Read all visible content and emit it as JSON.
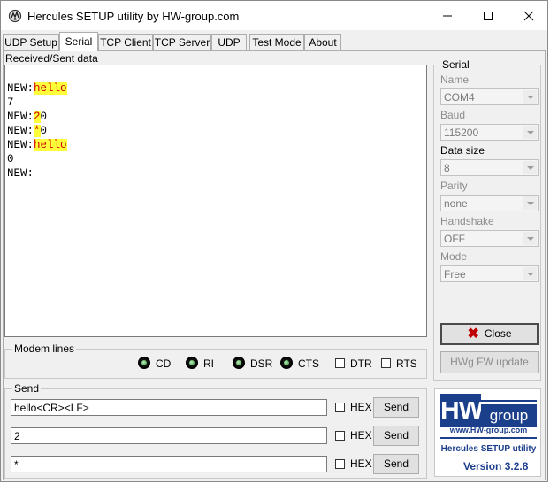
{
  "window": {
    "title": "Hercules SETUP utility by HW-group.com"
  },
  "tabs": [
    {
      "label": "UDP Setup",
      "active": false
    },
    {
      "label": "Serial",
      "active": true
    },
    {
      "label": "TCP Client",
      "active": false
    },
    {
      "label": "TCP Server",
      "active": false
    },
    {
      "label": "UDP",
      "active": false
    },
    {
      "label": "Test Mode",
      "active": false
    },
    {
      "label": "About",
      "active": false
    }
  ],
  "received": {
    "label": "Received/Sent data",
    "lines": [
      {
        "prefix": "NEW:",
        "highlight": "hello",
        "rest": ""
      },
      {
        "prefix": "7",
        "highlight": "",
        "rest": ""
      },
      {
        "prefix": "NEW:",
        "highlight": "2",
        "rest": "0"
      },
      {
        "prefix": "NEW:",
        "highlight": "*",
        "rest": "0"
      },
      {
        "prefix": "NEW:",
        "highlight": "hello",
        "rest": ""
      },
      {
        "prefix": "0",
        "highlight": "",
        "rest": ""
      },
      {
        "prefix": "NEW:",
        "highlight": "",
        "rest": ""
      }
    ]
  },
  "serial": {
    "group_label": "Serial",
    "name": {
      "label": "Name",
      "value": "COM4"
    },
    "baud": {
      "label": "Baud",
      "value": "115200"
    },
    "data_size": {
      "label": "Data size",
      "value": "8"
    },
    "parity": {
      "label": "Parity",
      "value": "none"
    },
    "handshake": {
      "label": "Handshake",
      "value": "OFF"
    },
    "mode": {
      "label": "Mode",
      "value": "Free"
    },
    "close_button": "Close",
    "fw_update_button": "HWg FW update"
  },
  "modem": {
    "group_label": "Modem lines",
    "indicators": [
      "CD",
      "RI",
      "DSR",
      "CTS"
    ],
    "checkboxes": [
      "DTR",
      "RTS"
    ]
  },
  "send": {
    "group_label": "Send",
    "rows": [
      {
        "value": "hello<CR><LF>",
        "hex_label": "HEX",
        "send_label": "Send"
      },
      {
        "value": "2",
        "hex_label": "HEX",
        "send_label": "Send"
      },
      {
        "value": "*",
        "hex_label": "HEX",
        "send_label": "Send"
      }
    ]
  },
  "logo": {
    "hw": "HW",
    "group": "group",
    "url": "www.HW-group.com",
    "product": "Hercules SETUP utility",
    "version": "Version  3.2.8"
  },
  "colors": {
    "highlight_bg": "#ffff3a",
    "highlight_text": "#d00000",
    "logo_blue": "#1c3f8c",
    "led_green": "#2e8a2e"
  }
}
